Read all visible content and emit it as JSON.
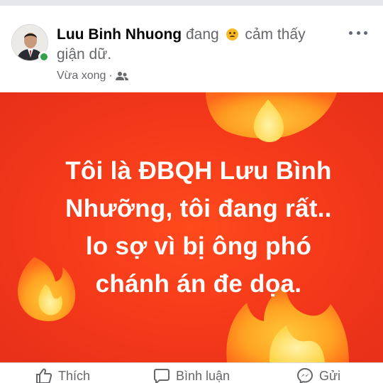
{
  "post": {
    "author_name": "Luu Binh Nhuong",
    "status_prefix": "đang",
    "feeling_icon": "angry-face-emoji",
    "feeling_text": "cảm thấy giận dữ.",
    "timestamp": "Vừa xong",
    "separator": "·",
    "audience_icon": "friends-icon",
    "online": true
  },
  "banner": {
    "text": "Tôi là ĐBQH Lưu Bình\nNhưỡng, tôi đang rất..\nlo sợ vì bị ông phó\nchánh án đe dọa.",
    "background": "#f4381a",
    "text_color": "#ffffff",
    "decoration": "fire-emoji"
  },
  "actions": {
    "like_label": "Thích",
    "comment_label": "Bình luận",
    "send_label": "Gửi"
  },
  "colors": {
    "name": "#050505",
    "secondary": "#65676b",
    "online": "#31a24c"
  }
}
